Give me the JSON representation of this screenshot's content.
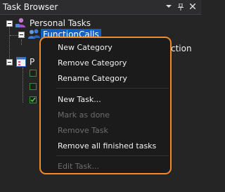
{
  "window": {
    "title": "Task Browser"
  },
  "tree": {
    "root_label": "Personal Tasks",
    "selected_node_label": "FunctionCalls",
    "partial_sibling_text": "ction",
    "second_root_partial": "P"
  },
  "context_menu": {
    "groups": [
      [
        {
          "label": "New Category",
          "enabled": true
        },
        {
          "label": "Remove Category",
          "enabled": true
        },
        {
          "label": "Rename Category",
          "enabled": true
        }
      ],
      [
        {
          "label": "New Task...",
          "enabled": true
        },
        {
          "label": "Mark as done",
          "enabled": false
        },
        {
          "label": "Remove Task",
          "enabled": false
        },
        {
          "label": "Remove all finished tasks",
          "enabled": true
        }
      ],
      [
        {
          "label": "Edit Task...",
          "enabled": false
        }
      ]
    ]
  },
  "colors": {
    "accent_outline": "#ef8a2a",
    "selection": "#0e62c7",
    "panel_bg": "#252526",
    "menu_bg": "#1b1b1c"
  },
  "icons": {
    "title_dropdown": "caret-down-icon",
    "title_pin": "pin-icon",
    "title_close": "close-icon",
    "root_node": "person-icon",
    "category_node": "people-group-icon",
    "task_list_node": "task-list-icon"
  }
}
